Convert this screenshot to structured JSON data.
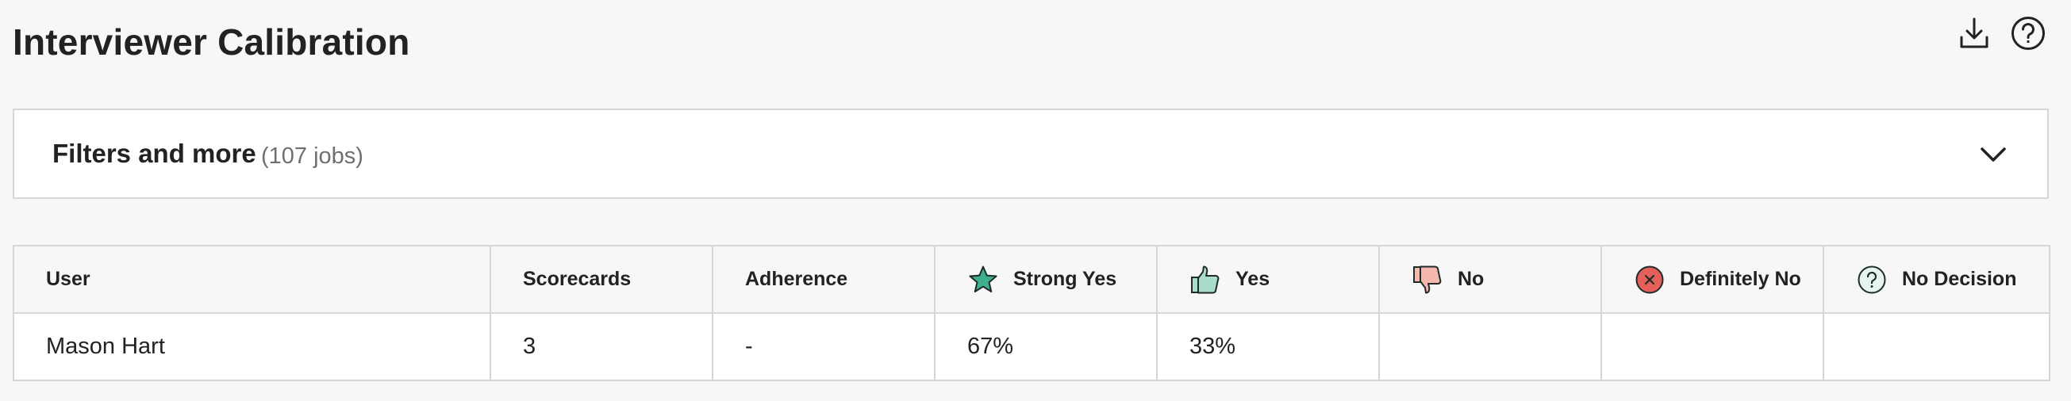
{
  "page": {
    "title": "Interviewer Calibration"
  },
  "header_icons": {
    "download": "download-icon",
    "help": "help-icon"
  },
  "filters": {
    "title": "Filters and more",
    "count": "(107 jobs)",
    "toggle_icon": "chevron-down-icon"
  },
  "table": {
    "columns": [
      {
        "label": "User",
        "icon": null
      },
      {
        "label": "Scorecards",
        "icon": null
      },
      {
        "label": "Adherence",
        "icon": null
      },
      {
        "label": "Strong Yes",
        "icon": "star-icon"
      },
      {
        "label": "Yes",
        "icon": "thumbs-up-icon"
      },
      {
        "label": "No",
        "icon": "thumbs-down-icon"
      },
      {
        "label": "Definitely No",
        "icon": "x-circle-icon"
      },
      {
        "label": "No Decision",
        "icon": "question-circle-icon"
      }
    ],
    "rows": [
      {
        "user": "Mason Hart",
        "scorecards": "3",
        "adherence": "-",
        "strong_yes": "67%",
        "yes": "33%",
        "no": "",
        "definitely_no": "",
        "no_decision": ""
      }
    ]
  },
  "colors": {
    "background": "#f7f7f7",
    "border": "#d6d6d6",
    "strong_yes": "#3fae8f",
    "yes": "#a9dccd",
    "no": "#f5b8ae",
    "definitely_no": "#e5605a",
    "no_decision": "#e7f3ef"
  }
}
